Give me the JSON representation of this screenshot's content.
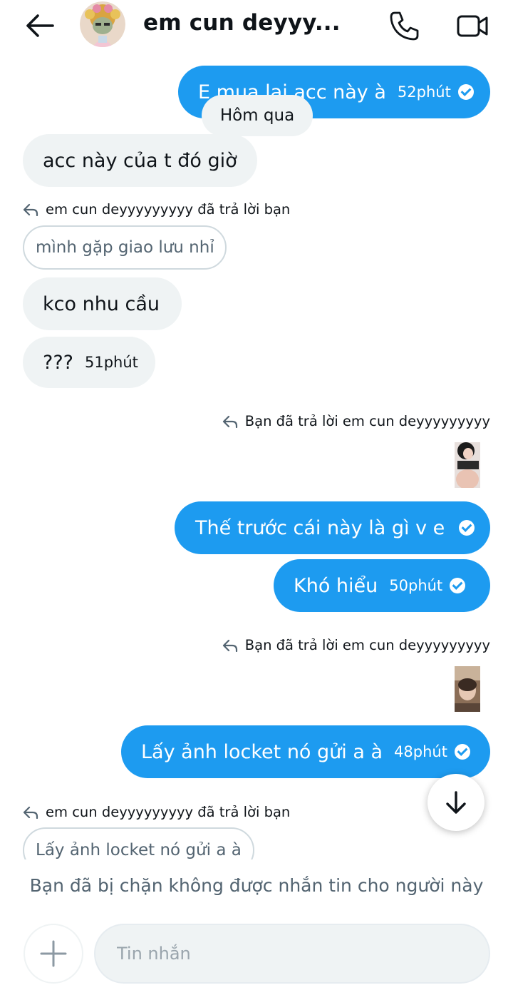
{
  "header": {
    "title": "em cun deyyy...",
    "back_icon": "arrow-left-icon",
    "call_icon": "phone-icon",
    "video_icon": "video-camera-icon"
  },
  "messages": {
    "m1": {
      "text": "E mua lại acc này à",
      "time": "52phút"
    },
    "date_separator": "Hôm qua",
    "m2": {
      "text": "acc này của t đó giờ"
    },
    "reply1": {
      "label": "em cun deyyyyyyyyy đã trả lời bạn",
      "quoted": "mình gặp giao lưu nhỉ"
    },
    "m3": {
      "text": "kco nhu cầu"
    },
    "m4": {
      "text": "???",
      "time": "51phút"
    },
    "reply2": {
      "label": "Bạn đã trả lời em cun deyyyyyyyyy"
    },
    "m5": {
      "text": "Thế trước cái này là gì v e"
    },
    "m6": {
      "text": "Khó hiểu",
      "time": "50phút"
    },
    "reply3": {
      "label": "Bạn đã trả lời em cun deyyyyyyyyy"
    },
    "m7": {
      "text": "Lấy ảnh locket nó gửi a à",
      "time": "48phút"
    },
    "reply4": {
      "label": "em cun deyyyyyyyyy đã trả lời bạn",
      "quoted": "Lấy ảnh locket nó gửi a à"
    }
  },
  "blocked_notice": "Bạn đã bị chặn không được nhắn tin cho người này",
  "composer": {
    "placeholder": "Tin nhắn",
    "add_icon": "plus-icon"
  },
  "colors": {
    "accent": "#1d9bf0",
    "incoming_bubble": "#eff3f4",
    "text": "#0f1419",
    "muted": "#536471"
  }
}
